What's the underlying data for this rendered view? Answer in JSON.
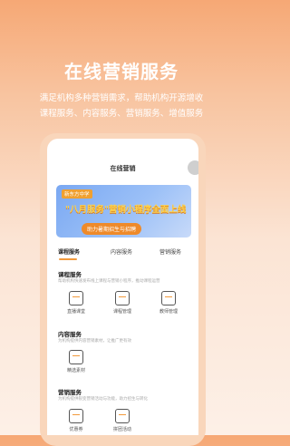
{
  "hero": {
    "title": "在线营销服务",
    "subtitle_line1": "满足机构多种营销需求，帮助机构开源增收",
    "subtitle_line2": "课程服务、内容服务、营销服务、增值服务"
  },
  "phone": {
    "screen_title": "在线营销",
    "banner": {
      "badge": "新东方中学",
      "headline": "\"八月服务\"营销小程序全面上线",
      "subline": "助力暑期招生与招聘"
    },
    "tabs": [
      {
        "label": "课程服务",
        "active": true
      },
      {
        "label": "内容服务",
        "active": false
      },
      {
        "label": "营销服务",
        "active": false
      }
    ],
    "sections": [
      {
        "title": "课程服务",
        "desc": "帮助机构快速发布线上课程与营销小程序，推动课程运营",
        "items": [
          {
            "label": "直播课堂",
            "icon": "video-course-icon"
          },
          {
            "label": "课程管理",
            "icon": "course-manage-icon"
          },
          {
            "label": "教师管理",
            "icon": "teacher-icon"
          }
        ]
      },
      {
        "title": "内容服务",
        "desc": "为机构提供内容营销素材，让推广更有效",
        "items": [
          {
            "label": "精选素材",
            "icon": "content-icon"
          }
        ]
      },
      {
        "title": "营销服务",
        "desc": "为机构提供裂变营销活动与功能，助力招生与转化",
        "items": [
          {
            "label": "优惠券",
            "icon": "coupon-icon"
          },
          {
            "label": "拼团活动",
            "icon": "group-buy-icon"
          }
        ]
      }
    ]
  },
  "colors": {
    "accent": "#f29a3c",
    "background_top": "#f6a875",
    "background_bottom": "#fdf0e7",
    "banner_blue": "#7aa8f2"
  }
}
